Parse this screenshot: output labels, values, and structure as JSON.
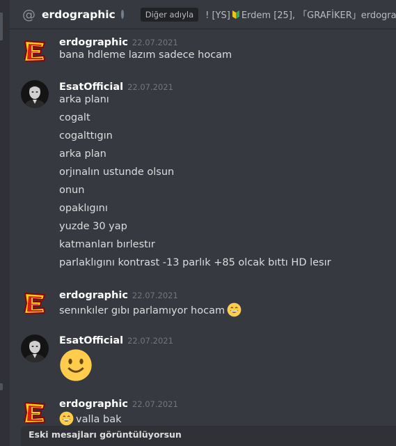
{
  "header": {
    "channel_icon": "at-icon",
    "dm_name": "erdographic",
    "status": "offline",
    "nick_label": "Diğer adıyla",
    "nick_prefix": "! [YS]",
    "nick_middle": "Erdem [25],",
    "nick_suffix": "「GRAFİKER」erdographic"
  },
  "messages": [
    {
      "author": "erdographic",
      "timestamp": "22.07.2021",
      "lines": [
        "bana hdleme lazım sadece hocam"
      ]
    },
    {
      "author": "EsatOfficial",
      "timestamp": "22.07.2021",
      "lines": [
        "arka planı",
        "cogalt",
        "cogalttıgın",
        "arka plan",
        "orjınalın ustunde olsun",
        "onun",
        "opaklıgını",
        "yuzde 30 yap",
        "katmanları bırlestır",
        "parlaklıgını  kontrast -13  parlık +85 olcak bıttı HD lesır"
      ]
    },
    {
      "author": "erdographic",
      "timestamp": "22.07.2021",
      "lines": [
        "senınkıler gıbı parlamıyor hocam"
      ],
      "emoji": "grinning-emoji"
    },
    {
      "author": "EsatOfficial",
      "timestamp": "22.07.2021",
      "emoji": "slightly-smiling-emoji"
    },
    {
      "author": "erdographic",
      "timestamp": "22.07.2021",
      "lines": [
        "valla bak"
      ],
      "emoji": "grinning-emoji"
    }
  ],
  "old_messages_bar": "Eski mesajları görüntülüyorsun",
  "colors": {
    "background": "#36393f",
    "sidebar": "#2f3136",
    "author": "#ffffff",
    "timestamp": "#72767d",
    "emoji": "#ffcc4d"
  }
}
